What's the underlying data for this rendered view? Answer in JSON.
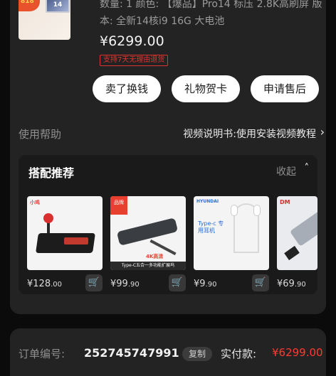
{
  "product": {
    "thumb_badge": "818",
    "thumb_model": "14",
    "spec_text": "数量: 1  颜色: 【爆品】Pro14 标压 2.8K高刷屏  版本: 全新14核i9 16G 大电池",
    "price": "¥6299.00",
    "refund_tag": "支持7天无理由退货"
  },
  "actions": [
    {
      "label": "卖了换钱"
    },
    {
      "label": "礼物贺卡"
    },
    {
      "label": "申请售后"
    }
  ],
  "help": {
    "label": "使用帮助",
    "link": "视频说明书:使用安装视频教程",
    "chevron": "›"
  },
  "recommend": {
    "title": "搭配推荐",
    "collapse": "收起",
    "caret": "˄",
    "items": [
      {
        "name": "arcade-joystick",
        "brand": "小鸡",
        "price_main": "¥128",
        "price_dec": ".00",
        "accent": "#e24a3b"
      },
      {
        "name": "usb-c-hub",
        "brand": "品牌",
        "caption": "Type-C五合一多功能扩展坞",
        "tag": "4K高清",
        "price_main": "¥99",
        "price_dec": ".90",
        "accent": "#e8402f"
      },
      {
        "name": "type-c-earphones",
        "brand": "HYUNDAI",
        "caption": "Type-c 专用耳机",
        "price_main": "¥9",
        "price_dec": ".90",
        "accent": "#2b6bd6"
      },
      {
        "name": "partial-product",
        "brand": "DM",
        "price_main": "¥69",
        "price_dec": ".90",
        "accent": "#c4362c"
      }
    ]
  },
  "order": {
    "label": "订单编号:",
    "number": "252745747991",
    "copy": "复制",
    "paid_label": "实付款:",
    "paid_value": "¥6299.00"
  },
  "colors": {
    "bg": "#0b0b0b",
    "card": "#232323",
    "accent_red": "#ff3b30"
  }
}
